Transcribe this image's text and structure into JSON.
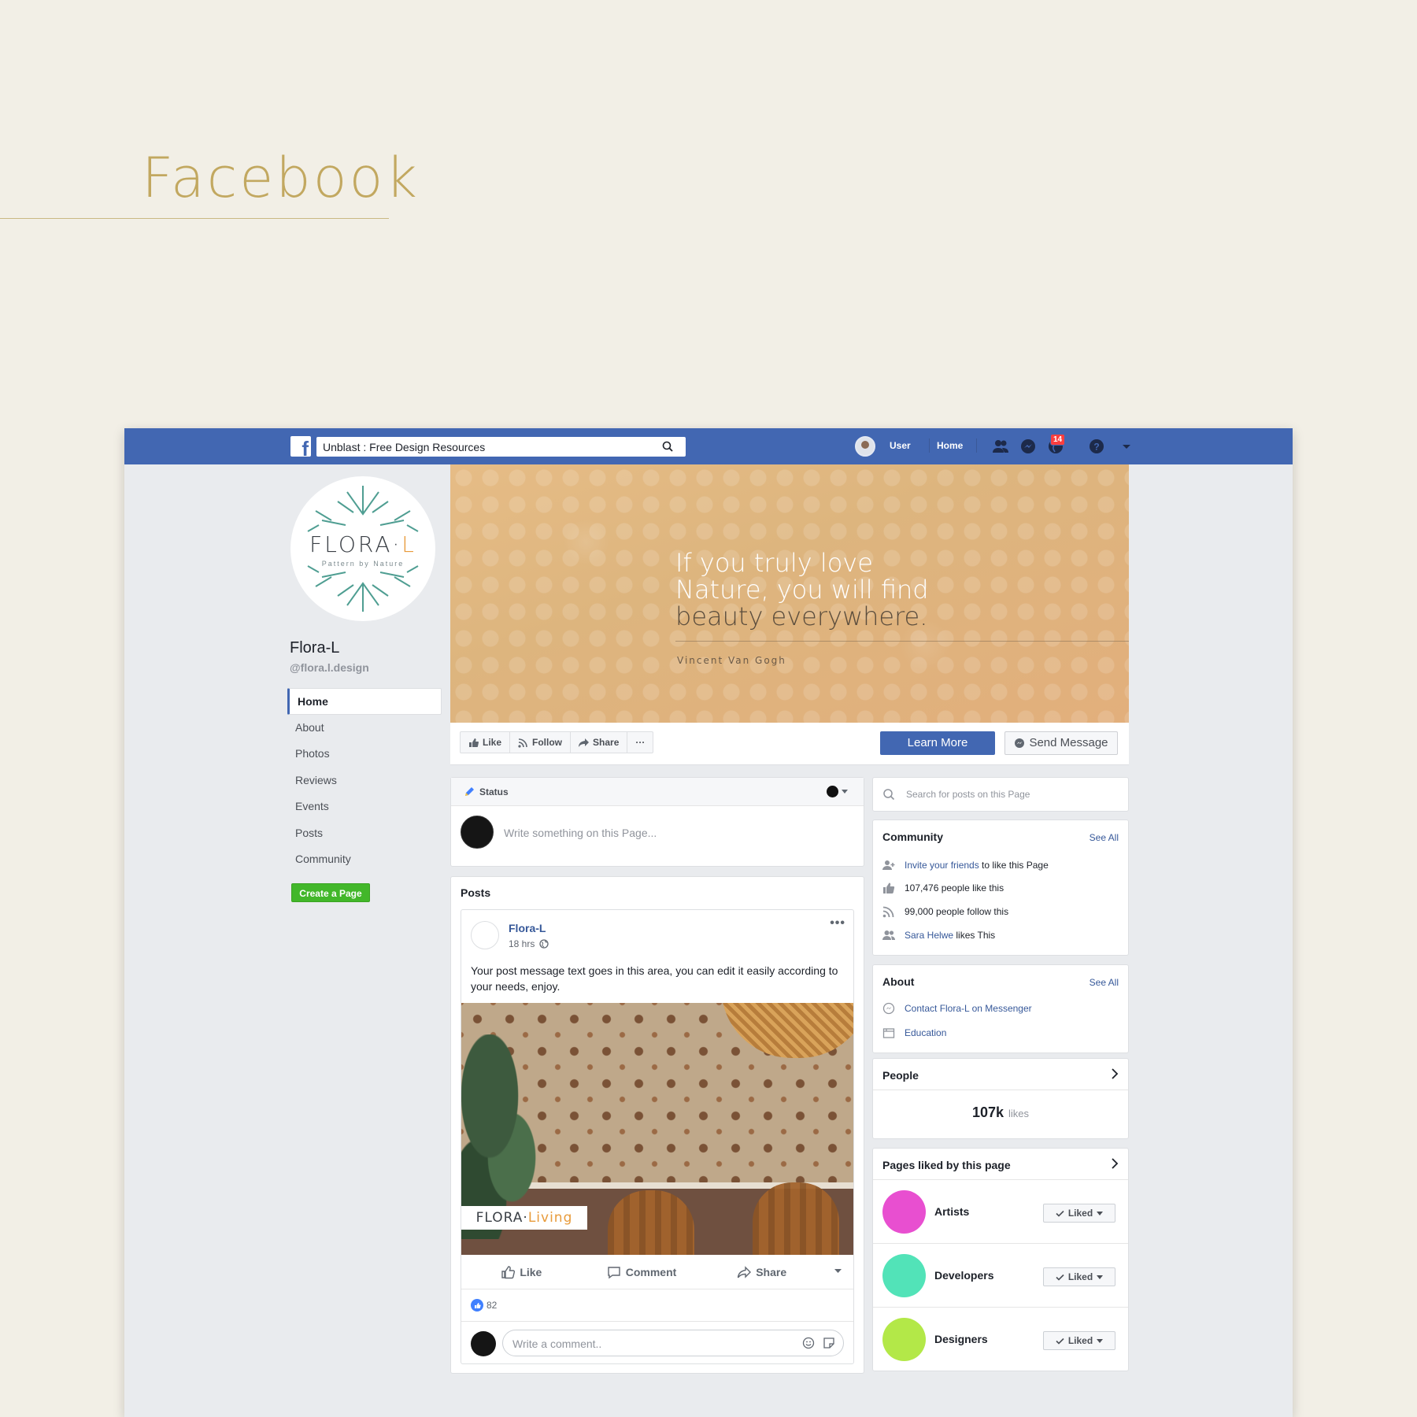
{
  "deck": {
    "title": "Facebook"
  },
  "topbar": {
    "search_value": "Unblast : Free Design Resources",
    "user_label": "User",
    "home_label": "Home",
    "notification_count": "14",
    "brand_color": "#4267b2"
  },
  "profile": {
    "logo_word": "FLORA",
    "logo_dot": "·",
    "logo_letter": "L",
    "logo_tagline": "Pattern by Nature",
    "name": "Flora-L",
    "handle": "@flora.l.design"
  },
  "nav": {
    "items": [
      {
        "label": "Home",
        "active": true
      },
      {
        "label": "About"
      },
      {
        "label": "Photos"
      },
      {
        "label": "Reviews"
      },
      {
        "label": "Events"
      },
      {
        "label": "Posts"
      },
      {
        "label": "Community"
      }
    ],
    "create_page": "Create a Page"
  },
  "cover": {
    "quote_line1": "If you truly love",
    "quote_line2": "Nature, you will find",
    "quote_line3": "beauty everywhere.",
    "author": "Vincent Van Gogh"
  },
  "actions": {
    "like": "Like",
    "follow": "Follow",
    "share": "Share",
    "more": "···",
    "learn_more": "Learn More",
    "send_message": "Send Message"
  },
  "composer": {
    "tab": "Status",
    "placeholder": "Write something on this Page..."
  },
  "posts": {
    "title": "Posts",
    "author": "Flora-L",
    "time": "18 hrs",
    "more": "•••",
    "text": "Your post message text goes in this area, you can edit it easily according to your needs, enjoy.",
    "image_label_word": "FLORA",
    "image_label_dot": "·",
    "image_label_living": "Living",
    "like": "Like",
    "comment": "Comment",
    "share": "Share",
    "reaction_count": "82",
    "comment_placeholder": "Write a comment.."
  },
  "sidebar": {
    "search_placeholder": "Search for posts on this Page",
    "community": {
      "title": "Community",
      "see_all": "See All",
      "invite_link": "Invite your friends",
      "invite_rest": " to like this Page",
      "likes_text": "107,476 people like this",
      "follows_text": "99,000 people follow this",
      "friend_name": "Sara Helwe",
      "friend_rest": " likes This"
    },
    "about": {
      "title": "About",
      "see_all": "See All",
      "contact": "Contact Flora-L on Messenger",
      "education": "Education"
    },
    "people": {
      "title": "People",
      "likes_count": "107k",
      "likes_label": "likes"
    },
    "pages_liked": {
      "title": "Pages liked by this page",
      "items": [
        {
          "name": "Artists",
          "color": "#e84fd0",
          "button": "Liked"
        },
        {
          "name": "Developers",
          "color": "#52e3b8",
          "button": "Liked"
        },
        {
          "name": "Designers",
          "color": "#b3e848",
          "button": "Liked"
        }
      ]
    }
  }
}
